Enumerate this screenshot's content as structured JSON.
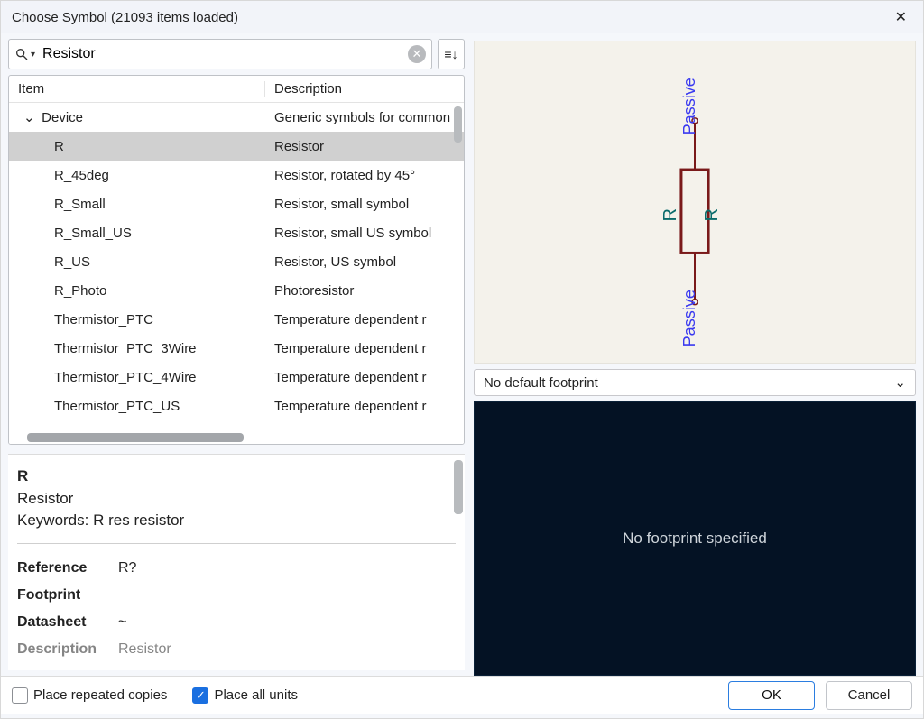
{
  "window": {
    "title": "Choose Symbol (21093 items loaded)"
  },
  "search": {
    "value": "Resistor",
    "placeholder": ""
  },
  "columns": {
    "item": "Item",
    "description": "Description"
  },
  "tree": {
    "library": {
      "name": "Device",
      "description": "Generic symbols for common"
    },
    "items": [
      {
        "name": "R",
        "description": "Resistor",
        "selected": true
      },
      {
        "name": "R_45deg",
        "description": "Resistor, rotated by 45°",
        "selected": false
      },
      {
        "name": "R_Small",
        "description": "Resistor, small symbol",
        "selected": false
      },
      {
        "name": "R_Small_US",
        "description": "Resistor, small US symbol",
        "selected": false
      },
      {
        "name": "R_US",
        "description": "Resistor, US symbol",
        "selected": false
      },
      {
        "name": "R_Photo",
        "description": "Photoresistor",
        "selected": false
      },
      {
        "name": "Thermistor_PTC",
        "description": "Temperature dependent r",
        "selected": false
      },
      {
        "name": "Thermistor_PTC_3Wire",
        "description": "Temperature dependent r",
        "selected": false
      },
      {
        "name": "Thermistor_PTC_4Wire",
        "description": "Temperature dependent r",
        "selected": false
      },
      {
        "name": "Thermistor_PTC_US",
        "description": "Temperature dependent r",
        "selected": false
      }
    ]
  },
  "details": {
    "name": "R",
    "type": "Resistor",
    "keywords_label": "Keywords:",
    "keywords": "R res resistor",
    "fields": {
      "reference_label": "Reference",
      "reference_value": "R?",
      "footprint_label": "Footprint",
      "footprint_value": "",
      "datasheet_label": "Datasheet",
      "datasheet_value": "~",
      "description_label": "Description",
      "description_value": "Resistor"
    }
  },
  "preview": {
    "pin_top": "Passive",
    "pin_bottom": "Passive",
    "ref_text": "R",
    "value_text": "R"
  },
  "footprint": {
    "select_label": "No default footprint",
    "view_message": "No footprint specified"
  },
  "options": {
    "repeated_label": "Place repeated copies",
    "repeated_checked": false,
    "all_units_label": "Place all units",
    "all_units_checked": true
  },
  "buttons": {
    "ok": "OK",
    "cancel": "Cancel"
  }
}
